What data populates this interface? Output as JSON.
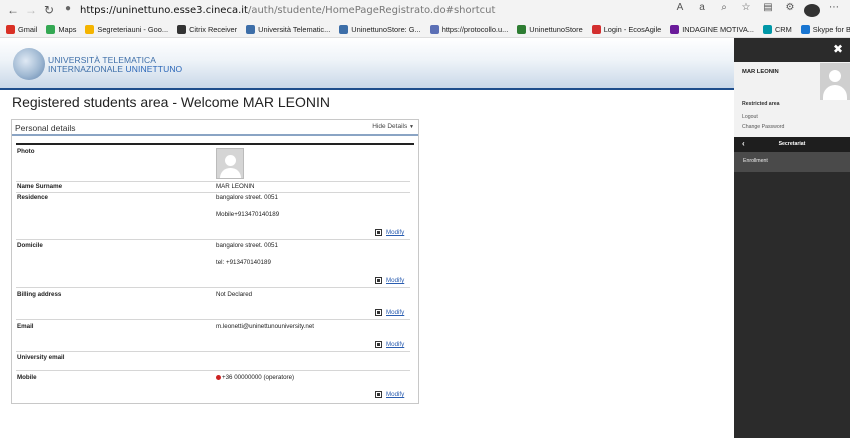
{
  "browser": {
    "url_host": "https://uninettuno.esse3.cineca.it",
    "url_path": "/auth/studente/HomePageRegistrato.do#shortcut",
    "bookmarks": [
      {
        "label": "Gmail",
        "color": "#d93025",
        "icon": "gmail-icon"
      },
      {
        "label": "Maps",
        "color": "#34a853",
        "icon": "maps-icon"
      },
      {
        "label": "Segreteriauni - Goo...",
        "color": "#f4b400",
        "icon": "drive-icon"
      },
      {
        "label": "Citrix Receiver",
        "color": "#333333",
        "icon": "citrix-icon"
      },
      {
        "label": "Università Telematic...",
        "color": "#3d6ea8",
        "icon": "globe-icon"
      },
      {
        "label": "UninettunoStore: G...",
        "color": "#3d6ea8",
        "icon": "globe-icon"
      },
      {
        "label": "https://protocollo.u...",
        "color": "#5b6fb5",
        "icon": "protocol-icon"
      },
      {
        "label": "UninettunoStore",
        "color": "#2e7d32",
        "icon": "store-icon"
      },
      {
        "label": "Login - EcosAgile",
        "color": "#d32f2f",
        "icon": "login-icon"
      },
      {
        "label": "INDAGINE MOTIVA...",
        "color": "#6a1b9a",
        "icon": "forms-icon"
      },
      {
        "label": "CRM",
        "color": "#0097a7",
        "icon": "crm-icon"
      },
      {
        "label": "Skype for Business",
        "color": "#1976d2",
        "icon": "skype-icon"
      }
    ]
  },
  "header": {
    "logo_line1": "UNIVERSITÀ TELEMATICA",
    "logo_line2a": "INTERNAZIONALE ",
    "logo_line2b": "UNINETTUNO"
  },
  "page": {
    "title": "Registered students area - Welcome MAR LEONIN",
    "panel_title": "Personal details",
    "hide_details": "Hide Details"
  },
  "details": {
    "photo_label": "Photo",
    "name_label": "Name Surname",
    "name_value": "MAR LEONIN",
    "residence_label": "Residence",
    "residence_address": "bangalore street. 0051",
    "residence_mobile": "Mobile+913470140189",
    "domicile_label": "Domicile",
    "domicile_address": "bangalore street. 0051",
    "domicile_tel": "tel: +913470140189",
    "billing_label": "Billing address",
    "billing_value": "Not Declared",
    "email_label": "Email",
    "email_value": "m.leonetti@uninettunouniversity.net",
    "university_email_label": "University email",
    "mobile_label": "Mobile",
    "mobile_value": "+36 00000000 (operatore)",
    "modify_label": "Modify"
  },
  "sidebar": {
    "user_name": "MAR LEONIN",
    "section_label": "Restricted area",
    "logout": "Logout",
    "change_password": "Change Password",
    "secretariat": "Secretariat",
    "enrollment": "Enrollment"
  }
}
